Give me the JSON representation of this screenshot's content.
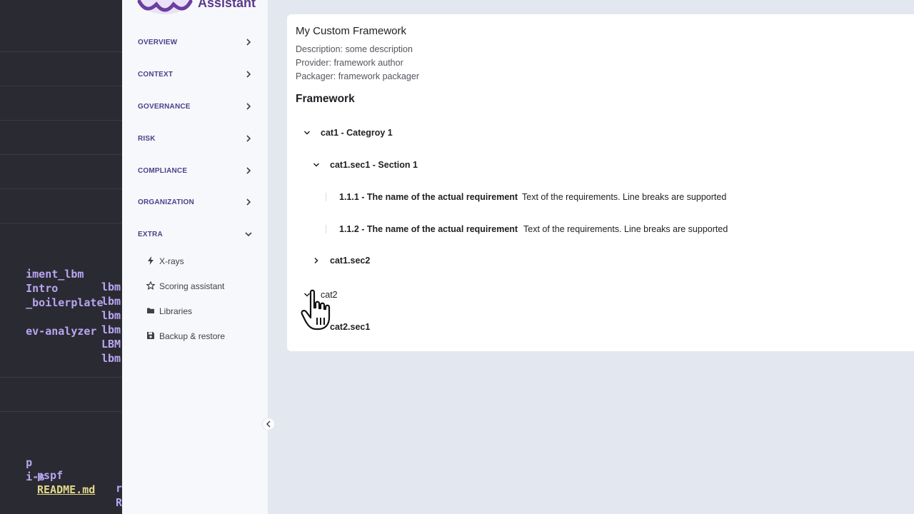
{
  "terminal": {
    "rows": [
      {
        "left": "iment_lbm",
        "right": "lbm"
      },
      {
        "left": "Intro",
        "right": "lbm"
      },
      {
        "left": "_boilerplate",
        "right": "lbm"
      },
      {
        "left": "",
        "right": "lbm"
      },
      {
        "left": "ev-analyzer",
        "right": "LBM"
      },
      {
        "left": "",
        "right": "lbm"
      }
    ],
    "bottom1": {
      "a": "p",
      "b": "pspf",
      "c": "r"
    },
    "bottom2": {
      "a": "i-s",
      "b": "README.md",
      "c": "R"
    }
  },
  "sidebar": {
    "app_name": "Assistant",
    "nav": [
      {
        "label": "OVERVIEW",
        "state": "collapsed"
      },
      {
        "label": "CONTEXT",
        "state": "collapsed"
      },
      {
        "label": "GOVERNANCE",
        "state": "collapsed"
      },
      {
        "label": "RISK",
        "state": "collapsed"
      },
      {
        "label": "COMPLIANCE",
        "state": "collapsed"
      },
      {
        "label": "ORGANIZATION",
        "state": "collapsed"
      },
      {
        "label": "EXTRA",
        "state": "expanded"
      }
    ],
    "extra_items": [
      {
        "label": "X-rays",
        "icon": "bolt-icon"
      },
      {
        "label": "Scoring assistant",
        "icon": "star-icon"
      },
      {
        "label": "Libraries",
        "icon": "folder-icon"
      },
      {
        "label": "Backup & restore",
        "icon": "floppy-icon"
      }
    ]
  },
  "framework": {
    "title": "My Custom Framework",
    "description": "Description: some description",
    "provider": "Provider: framework author",
    "packager": "Packager: framework packager",
    "heading": "Framework",
    "tree": {
      "cat1": "cat1 - Categroy 1",
      "cat1_sec1": "cat1.sec1 - Section 1",
      "req1_name": "1.1.1 - The name of the actual requirement",
      "req1_text": "Text of the requirements. Line breaks are supported",
      "req2_name": "1.1.2 - The name of the actual requirement",
      "req2_text": "Text of the requirements. Line breaks are supported",
      "cat1_sec2": "cat1.sec2",
      "cat2": "cat2",
      "cat2_sec1": "cat2.sec1"
    }
  },
  "colors": {
    "accent": "#4b3f8c",
    "terminal_bg": "#2a2a33",
    "page_bg": "#e3e8f0"
  }
}
